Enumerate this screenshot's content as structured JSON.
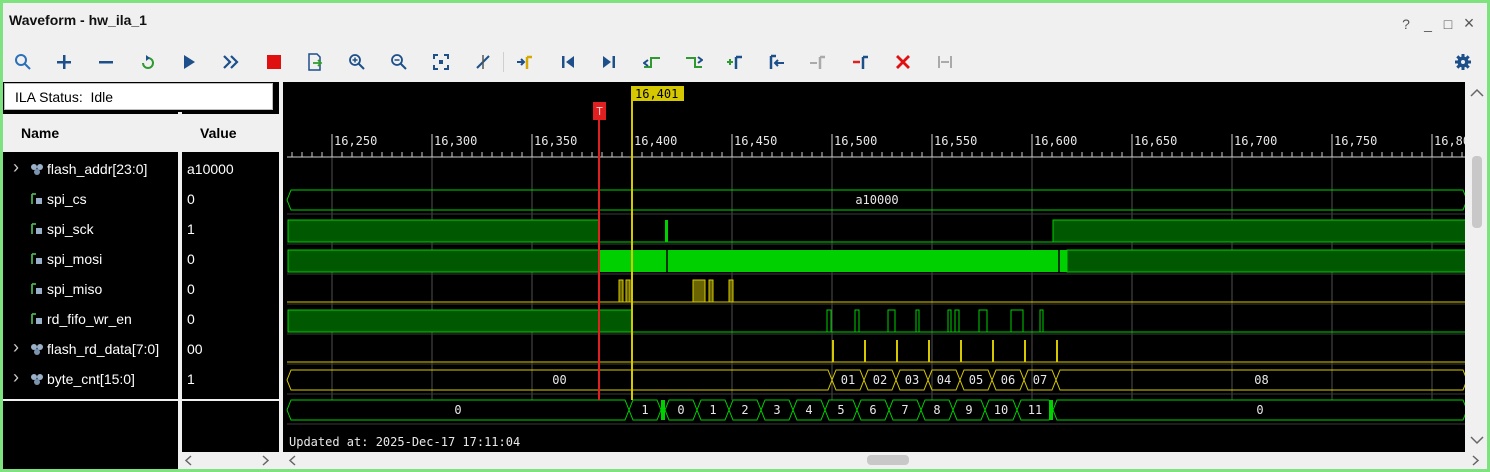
{
  "window": {
    "title": "Waveform - hw_ila_1",
    "controls": [
      "?",
      "_",
      "□",
      "×"
    ]
  },
  "toolbar": {
    "buttons": [
      "search-icon",
      "add-icon",
      "remove-icon",
      "refresh-icon",
      "run-icon",
      "run-all-icon",
      "stop-icon",
      "export-icon",
      "zoom-in-icon",
      "zoom-out-icon",
      "zoom-fit-icon",
      "cursor-icon",
      "goto-marker-icon",
      "first-icon",
      "last-icon",
      "prev-transition-icon",
      "next-transition-icon",
      "add-marker-icon",
      "prev-marker-icon",
      "next-marker-icon",
      "remove-marker-icon",
      "delete-icon",
      "swap-cursor-icon"
    ],
    "settings_icon": "gear-icon"
  },
  "ila_status": {
    "label": "ILA Status:",
    "value": "Idle"
  },
  "columns": {
    "name": "Name",
    "value": "Value"
  },
  "signals": [
    {
      "name": "flash_addr[23:0]",
      "value": "a10000",
      "type": "bus",
      "expandable": true
    },
    {
      "name": "spi_cs",
      "value": "0",
      "type": "bit",
      "expandable": false
    },
    {
      "name": "spi_sck",
      "value": "1",
      "type": "bit",
      "expandable": false
    },
    {
      "name": "spi_mosi",
      "value": "0",
      "type": "bit",
      "expandable": false
    },
    {
      "name": "spi_miso",
      "value": "0",
      "type": "bit",
      "expandable": false
    },
    {
      "name": "rd_fifo_wr_en",
      "value": "0",
      "type": "bit",
      "expandable": false
    },
    {
      "name": "flash_rd_data[7:0]",
      "value": "00",
      "type": "bus",
      "expandable": true
    },
    {
      "name": "byte_cnt[15:0]",
      "value": "1",
      "type": "bus",
      "expandable": true
    }
  ],
  "waveform": {
    "cursor_label": "16,401",
    "trigger_label": "T",
    "ticks": [
      "16,250",
      "16,300",
      "16,350",
      "16,400",
      "16,450",
      "16,500",
      "16,550",
      "16,600",
      "16,650",
      "16,700",
      "16,750",
      "16,80"
    ],
    "flash_addr_value": "a10000",
    "flash_rd_data_values": [
      "00",
      "01",
      "02",
      "03",
      "04",
      "05",
      "06",
      "07",
      "08"
    ],
    "byte_cnt_values": [
      "0",
      "1",
      "0",
      "1",
      "2",
      "3",
      "4",
      "5",
      "6",
      "7",
      "8",
      "9",
      "10",
      "11",
      "0"
    ],
    "updated_label": "Updated at: 2025-Dec-17 17:11:04",
    "colors": {
      "signal": "#00d000",
      "cursor": "#d6c800",
      "trigger": "#e02020",
      "grid": "#505050",
      "background": "#000000"
    }
  }
}
